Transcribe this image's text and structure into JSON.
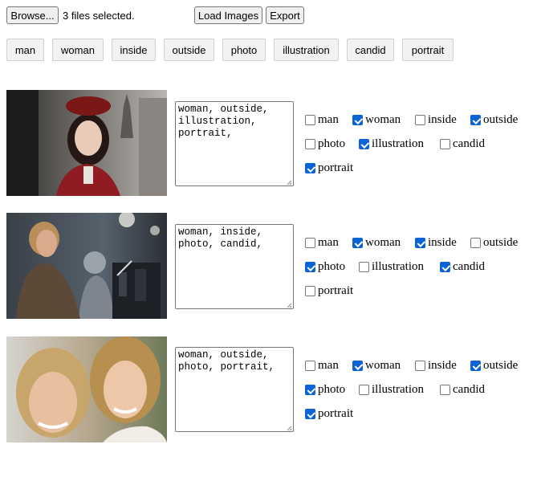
{
  "toolbar": {
    "browse_label": "Browse...",
    "files_status": "3 files selected.",
    "load_label": "Load Images",
    "export_label": "Export"
  },
  "tags": [
    "man",
    "woman",
    "inside",
    "outside",
    "photo",
    "illustration",
    "candid",
    "portrait"
  ],
  "images": [
    {
      "tag_text": "woman, outside,\nillustration,\nportrait,",
      "checked": {
        "man": false,
        "woman": true,
        "inside": false,
        "outside": true,
        "photo": false,
        "illustration": true,
        "candid": false,
        "portrait": true
      }
    },
    {
      "tag_text": "woman, inside,\nphoto, candid,",
      "checked": {
        "man": false,
        "woman": true,
        "inside": true,
        "outside": false,
        "photo": true,
        "illustration": false,
        "candid": true,
        "portrait": false
      }
    },
    {
      "tag_text": "woman, outside,\nphoto, portrait,",
      "checked": {
        "man": false,
        "woman": true,
        "inside": false,
        "outside": true,
        "photo": true,
        "illustration": false,
        "candid": false,
        "portrait": true
      }
    }
  ],
  "colors": {
    "checkbox_checked": "#0b63d6",
    "button_bg": "#efefef",
    "tag_button_bg": "#f2f2f2"
  }
}
